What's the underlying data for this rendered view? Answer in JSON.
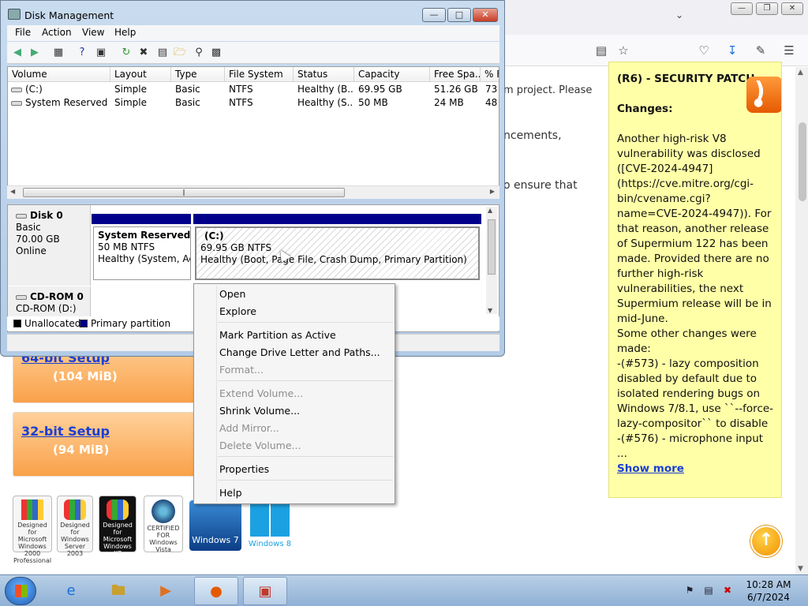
{
  "browser": {
    "page_text": [
      "m project. Please",
      "ncements,",
      "o ensure that"
    ],
    "setup": [
      {
        "link": "64-bit Setup",
        "size": "(104 MiB)"
      },
      {
        "link": "32-bit Setup",
        "size": "(94 MiB)"
      }
    ],
    "logos": [
      "Designed for Microsoft Windows 2000 Professional",
      "Designed for Windows Server 2003",
      "Designed for Microsoft Windows XP",
      "CERTIFIED FOR Windows Vista",
      "Windows 7",
      "Windows 8"
    ],
    "sidebar": {
      "heading": "(R6) - SECURITY PATCH",
      "changes_label": "Changes:",
      "paragraph1": "Another high-risk V8 vulnerability was disclosed ([CVE-2024-4947](https://cve.mitre.org/cgi-bin/cvename.cgi?name=CVE-2024-4947)). For that reason, another release of Supermium 122 has been made. Provided there are no further high-risk vulnerabilities, the next Supermium release will be in mid-June.",
      "paragraph2": "Some other changes were made:",
      "paragraph3": "-(#573) - lazy composition disabled by default due to isolated rendering bugs on Windows 7/8.1, use ``--force-lazy-compositor`` to disable",
      "paragraph4": "-(#576) - microphone input ...",
      "show_more": "Show more"
    }
  },
  "disk_mgmt": {
    "title": "Disk Management",
    "menu": [
      "File",
      "Action",
      "View",
      "Help"
    ],
    "columns": [
      "Volume",
      "Layout",
      "Type",
      "File System",
      "Status",
      "Capacity",
      "Free Spa...",
      "% F"
    ],
    "rows": [
      [
        "(C:)",
        "Simple",
        "Basic",
        "NTFS",
        "Healthy (B...",
        "69.95 GB",
        "51.26 GB",
        "73"
      ],
      [
        "System Reserved",
        "Simple",
        "Basic",
        "NTFS",
        "Healthy (S...",
        "50 MB",
        "24 MB",
        "48"
      ]
    ],
    "disk0": {
      "name": "Disk 0",
      "type": "Basic",
      "size": "70.00 GB",
      "state": "Online"
    },
    "partition_reserved": {
      "name": "System Reserved",
      "size": "50 MB NTFS",
      "status": "Healthy (System, Acti"
    },
    "partition_c": {
      "name": "(C:)",
      "size": "69.95 GB NTFS",
      "status": "Healthy (Boot, Page File, Crash Dump, Primary Partition)"
    },
    "cdrom": {
      "name": "CD-ROM 0",
      "drive": "CD-ROM (D:)"
    },
    "legend": {
      "unallocated": "Unallocated",
      "primary": "Primary partition"
    }
  },
  "context_menu": {
    "items": [
      {
        "label": "Open",
        "enabled": true
      },
      {
        "label": "Explore",
        "enabled": true
      },
      {
        "label": "Mark Partition as Active",
        "enabled": true
      },
      {
        "label": "Change Drive Letter and Paths...",
        "enabled": true
      },
      {
        "label": "Format...",
        "enabled": false
      },
      {
        "label": "Extend Volume...",
        "enabled": false
      },
      {
        "label": "Shrink Volume...",
        "enabled": true
      },
      {
        "label": "Add Mirror...",
        "enabled": false
      },
      {
        "label": "Delete Volume...",
        "enabled": false
      },
      {
        "label": "Properties",
        "enabled": true
      },
      {
        "label": "Help",
        "enabled": true
      }
    ]
  },
  "taskbar": {
    "time": "10:28 AM",
    "date": "6/7/2024"
  },
  "colors": {
    "primary_partition": "#00008b",
    "sidebar_bg": "#ffffa8",
    "link": "#1a3fd4"
  }
}
